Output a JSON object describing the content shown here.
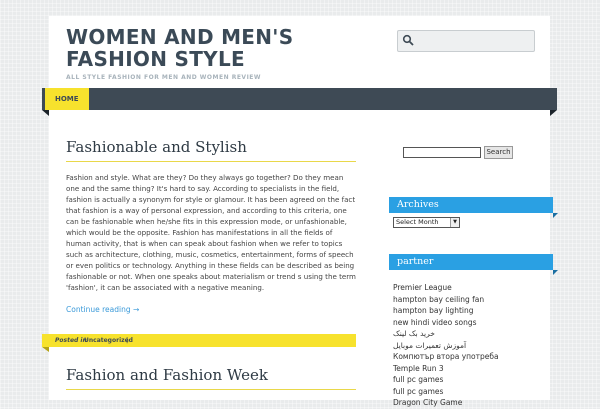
{
  "header": {
    "site_title": "WOMEN AND MEN'S FASHION STYLE",
    "tagline": "ALL STYLE FASHION FOR MEN AND WOMEN REVIEW",
    "search_placeholder": ""
  },
  "nav": {
    "home_label": "HOME"
  },
  "posts": [
    {
      "title": "Fashionable and Stylish",
      "body": "Fashion and style. What are they? Do they always go together? Do they mean one and the same thing? It's hard to say. According to specialists in the field, fashion is actually a synonym for style or glamour. It has been agreed on the fact that fashion is a way of personal expression, and according to this criteria, one can be fashionable when he/she fits in this expression mode, or unfashionable, which would be the opposite. Fashion has manifestations in all the fields of human activity, that is when can speak about fashion when we refer to topics such as architecture, clothing, music, cosmetics, entertainment, forms of speech or even politics or technology. Anything in these fields can be described as being fashionable or not. When one speaks about materialism or trend s using the term 'fashion', it can be associated with a negative meaning.",
      "read_more": "Continue reading →",
      "meta_posted": "Posted in",
      "meta_category": "Uncategorized",
      "meta_sep": "|"
    },
    {
      "title": "Fashion and Fashion Week"
    }
  ],
  "sidebar": {
    "search_button": "Search",
    "archives_title": "Archives",
    "archives_selected": "Select Month",
    "partner_title": "partner",
    "partner_links": [
      "Premier League",
      "hampton bay ceiling fan",
      "hampton bay lighting",
      "new hindi video songs",
      "خرید بک لینک",
      "آموزش تعمیرات موبایل",
      "Компютър втора употреба",
      "Temple Run 3",
      "full pc games",
      "full pc games",
      "Dragon City Game"
    ]
  },
  "colors": {
    "accent_yellow": "#f7e22d",
    "nav_dark": "#3e4a55",
    "widget_blue": "#2aa0e3",
    "link_blue": "#3b9ad9"
  }
}
